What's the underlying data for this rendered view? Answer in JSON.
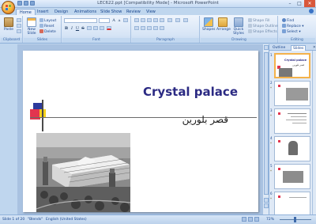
{
  "window": {
    "title": "LEC622.ppt [Compatibility Mode] - Microsoft PowerPoint"
  },
  "tabs": [
    {
      "label": "Home"
    },
    {
      "label": "Insert"
    },
    {
      "label": "Design"
    },
    {
      "label": "Animations"
    },
    {
      "label": "Slide Show"
    },
    {
      "label": "Review"
    },
    {
      "label": "View"
    }
  ],
  "ribbon": {
    "clipboard": {
      "paste": "Paste",
      "group": "Clipboard"
    },
    "slides": {
      "new_slide": "New Slide",
      "layout": "Layout",
      "reset": "Reset",
      "delete": "Delete",
      "group": "Slides"
    },
    "font": {
      "group": "Font",
      "bold": "B",
      "italic": "I",
      "underline": "U",
      "strike": "S",
      "aa_big": "A",
      "aa_small": "A"
    },
    "paragraph": {
      "group": "Paragraph"
    },
    "drawing": {
      "shapes": "Shapes",
      "arrange": "Arrange",
      "quick_styles": "Quick Styles",
      "shape_fill": "Shape Fill",
      "shape_outline": "Shape Outline",
      "shape_effects": "Shape Effects",
      "group": "Drawing"
    },
    "editing": {
      "find": "Find",
      "replace": "Replace",
      "select": "Select",
      "group": "Editing"
    }
  },
  "slide": {
    "title": "Crystal palace",
    "subtitle": "قصر بلورين"
  },
  "pane": {
    "tab_outline": "Outline",
    "tab_slides": "Slides",
    "thumb_title": "Crystal palace",
    "thumb_subtitle": "قصر بلورين",
    "slides": [
      {
        "num": "1",
        "star": "",
        "selected": true
      },
      {
        "num": "2",
        "star": "*",
        "selected": false
      },
      {
        "num": "3",
        "star": "*",
        "selected": false
      },
      {
        "num": "4",
        "star": "*",
        "selected": false
      },
      {
        "num": "5",
        "star": "*",
        "selected": false
      },
      {
        "num": "6",
        "star": "*",
        "selected": false
      }
    ]
  },
  "status": {
    "slide_of": "Slide 1 of 20",
    "theme": "\"Blends\"",
    "language": "English (United States)",
    "zoom": "72%"
  },
  "colors": {
    "title_blue": "#2b2a83",
    "deco_yellow": "#f5d11b",
    "deco_red": "#e2354f",
    "deco_blue": "#2d3a9c",
    "accent_orange": "#f4b24b"
  }
}
